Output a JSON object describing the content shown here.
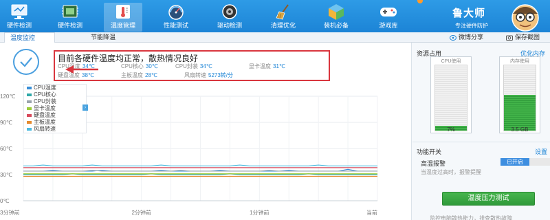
{
  "toolbar": {
    "items": [
      {
        "label": "硬件检测",
        "icon": "monitor-icon"
      },
      {
        "label": "硬件检测",
        "icon": "chip-icon"
      },
      {
        "label": "温度管理",
        "icon": "thermometer-icon"
      },
      {
        "label": "性能测试",
        "icon": "gauge-icon"
      },
      {
        "label": "驱动检测",
        "icon": "driver-icon"
      },
      {
        "label": "清理优化",
        "icon": "broom-icon"
      },
      {
        "label": "装机必备",
        "icon": "cube-icon"
      },
      {
        "label": "游戏库",
        "icon": "gamepad-icon"
      }
    ],
    "active_index": 2
  },
  "brand": {
    "name": "鲁大师",
    "slogan": "专注硬件防护"
  },
  "tabs": [
    {
      "label": "温度监控",
      "active": true
    },
    {
      "label": "节能降温",
      "active": false
    }
  ],
  "share": {
    "weibo": "微博分享",
    "save": "保存截图"
  },
  "status": {
    "headline": "目前各硬件温度均正常，散热情况良好",
    "readings": [
      {
        "label": "CPU温度",
        "value": "34℃"
      },
      {
        "label": "CPU核心",
        "value": "30℃"
      },
      {
        "label": "CPU封装",
        "value": "34℃"
      },
      {
        "label": "显卡温度",
        "value": "31℃"
      },
      {
        "label": "硬盘温度",
        "value": "38℃"
      },
      {
        "label": "主板温度",
        "value": "28℃"
      },
      {
        "label": "风扇转速",
        "value": "5273转/分"
      }
    ]
  },
  "chart_data": {
    "type": "line",
    "title": "",
    "xlabel": "",
    "ylabel": "",
    "x_ticks": [
      "3分钟前",
      "2分钟前",
      "1分钟前",
      "当前"
    ],
    "y_ticks": [
      "120℃",
      "90℃",
      "60℃",
      "30℃",
      "0℃"
    ],
    "ylim": [
      0,
      120
    ],
    "grid": true,
    "legend_position": "top-left",
    "x": [
      0,
      1,
      2,
      3,
      4,
      5,
      6,
      7,
      8,
      9,
      10,
      11,
      12,
      13,
      14,
      15,
      16,
      17,
      18,
      19,
      20,
      21,
      22,
      23,
      24,
      25,
      26,
      27,
      28,
      29,
      30,
      31,
      32,
      33,
      34,
      35,
      36
    ],
    "series": [
      {
        "name": "CPU温度",
        "color": "#3a8fd8",
        "values": [
          34,
          34,
          34,
          35,
          34,
          34,
          34,
          34,
          35,
          34,
          34,
          34,
          34,
          34,
          35,
          34,
          34,
          34,
          34,
          34,
          35,
          34,
          34,
          34,
          34,
          34,
          34,
          35,
          34,
          34,
          34,
          34,
          34,
          36,
          34,
          34,
          34
        ]
      },
      {
        "name": "CPU核心",
        "color": "#2fa8a8",
        "values": [
          30,
          30,
          30,
          30,
          30,
          31,
          30,
          30,
          30,
          30,
          30,
          30,
          30,
          31,
          30,
          30,
          30,
          30,
          30,
          30,
          30,
          31,
          30,
          30,
          30,
          30,
          30,
          30,
          30,
          31,
          30,
          30,
          30,
          30,
          30,
          30,
          30
        ]
      },
      {
        "name": "CPU封装",
        "color": "#9aa4ad",
        "values": [
          34,
          34,
          34,
          34,
          34,
          34,
          34,
          35,
          34,
          34,
          34,
          34,
          34,
          34,
          34,
          34,
          35,
          34,
          34,
          34,
          34,
          34,
          34,
          34,
          34,
          35,
          34,
          34,
          34,
          34,
          34,
          34,
          34,
          34,
          34,
          34,
          34
        ]
      },
      {
        "name": "显卡温度",
        "color": "#9ccc3a",
        "values": [
          31,
          31,
          31,
          31,
          31,
          31,
          31,
          31,
          31,
          31,
          31,
          31,
          31,
          31,
          31,
          31,
          31,
          31,
          31,
          31,
          31,
          31,
          31,
          31,
          31,
          31,
          31,
          31,
          31,
          31,
          31,
          31,
          31,
          31,
          31,
          31,
          31
        ]
      },
      {
        "name": "硬盘温度",
        "color": "#d8495b",
        "values": [
          38,
          38,
          38,
          38,
          38,
          38,
          38,
          38,
          38,
          38,
          38,
          38,
          38,
          38,
          38,
          38,
          38,
          38,
          38,
          38,
          38,
          38,
          38,
          38,
          38,
          38,
          38,
          38,
          38,
          38,
          38,
          38,
          38,
          38,
          38,
          38,
          38
        ]
      },
      {
        "name": "主板温度",
        "color": "#e58a2e",
        "values": [
          28,
          28,
          28,
          28,
          28,
          28,
          28,
          28,
          28,
          28,
          28,
          28,
          28,
          28,
          28,
          28,
          28,
          28,
          28,
          28,
          28,
          28,
          28,
          28,
          28,
          28,
          28,
          28,
          28,
          28,
          28,
          28,
          28,
          28,
          28,
          28,
          28
        ]
      },
      {
        "name": "风扇转速",
        "color": "#4dbbe0",
        "values": [
          40,
          40,
          41,
          40,
          40,
          40,
          40,
          41,
          40,
          40,
          40,
          40,
          40,
          40,
          41,
          40,
          40,
          40,
          40,
          40,
          40,
          40,
          41,
          40,
          40,
          40,
          40,
          40,
          40,
          40,
          41,
          40,
          40,
          40,
          40,
          40,
          40
        ]
      }
    ]
  },
  "resources": {
    "title": "资源占用",
    "optimize": "优化内存",
    "cpu": {
      "label": "CPU使用",
      "percent": 7,
      "value": "7%"
    },
    "memory": {
      "label": "内存使用",
      "percent": 55,
      "value": "3.5 GB"
    }
  },
  "functions": {
    "title": "功能开关",
    "settings": "设置",
    "alarm_label": "高温报警",
    "alarm_state": "已开启",
    "alarm_desc": "当温度过高时，报警提醒",
    "stress_button": "温度压力测试",
    "stress_desc": "监控电脑散热能力，排查散热故障"
  },
  "colors": {
    "accent": "#1c84d6",
    "alert": "#d9363e",
    "ok": "#3a9e44"
  }
}
